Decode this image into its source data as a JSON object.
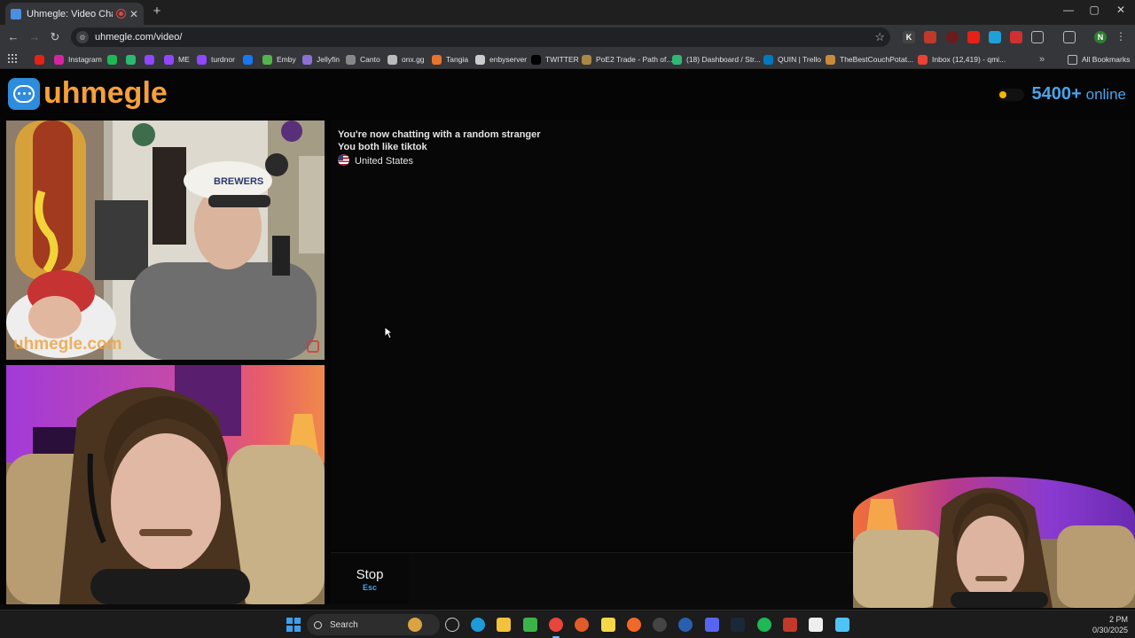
{
  "browser": {
    "tab_title": "Uhmegle: Video Chat | Rand",
    "new_tab_symbol": "+",
    "close_tab_symbol": "✕",
    "url": "uhmegle.com/video/",
    "window_controls": {
      "minimize": "—",
      "maximize": "▢",
      "close": "✕"
    }
  },
  "bookmarks": {
    "items": [
      {
        "label": "",
        "icon_color": "#e62117"
      },
      {
        "label": "Instagram",
        "icon_color": "#d6249f"
      },
      {
        "label": "",
        "icon_color": "#1db954"
      },
      {
        "label": "",
        "icon_color": "#2eb872"
      },
      {
        "label": "",
        "icon_color": "#9146ff"
      },
      {
        "label": "ME",
        "icon_color": "#9146ff"
      },
      {
        "label": "turdnor",
        "icon_color": "#9146ff"
      },
      {
        "label": "",
        "icon_color": "#1877f2"
      },
      {
        "label": "Emby",
        "icon_color": "#52b54b"
      },
      {
        "label": "Jellyfin",
        "icon_color": "#8e6fd8"
      },
      {
        "label": "Canto",
        "icon_color": "#888888"
      },
      {
        "label": "onx.gg",
        "icon_color": "#bbbbbb"
      },
      {
        "label": "Tangia",
        "icon_color": "#e8732c"
      },
      {
        "label": "enbyserver",
        "icon_color": "#cccccc"
      },
      {
        "label": "TWITTER",
        "icon_color": "#000000"
      },
      {
        "label": "PoE2 Trade - Path of...",
        "icon_color": "#aa8844"
      },
      {
        "label": "(18) Dashboard / Str...",
        "icon_color": "#2eb872"
      },
      {
        "label": "QUIN | Trello",
        "icon_color": "#0079bf"
      },
      {
        "label": "TheBestCouchPotat...",
        "icon_color": "#c98a3a"
      },
      {
        "label": "Inbox (12,419) - qmi...",
        "icon_color": "#ea4335"
      }
    ],
    "overflow": "»",
    "all_bookmarks": "All Bookmarks"
  },
  "site": {
    "logo_text": "uhmegle",
    "online_count": "5400+",
    "online_label": "online"
  },
  "chat": {
    "line1": "You're now chatting with a random stranger",
    "line2": "You both like tiktok",
    "country": "United States"
  },
  "controls": {
    "stop_label": "Stop",
    "stop_key": "Esc"
  },
  "videos": {
    "stranger_watermark": "uhmegle.com",
    "stranger_hat_text": "BREWERS"
  },
  "taskbar": {
    "search_label": "Search",
    "time": "2 PM",
    "date": "0/30/2025"
  },
  "colors": {
    "brand_orange": "#f5a03a",
    "brand_blue": "#2d8cdb",
    "accent_blue": "#4aa3ea",
    "status_dot": "#f4b400"
  }
}
